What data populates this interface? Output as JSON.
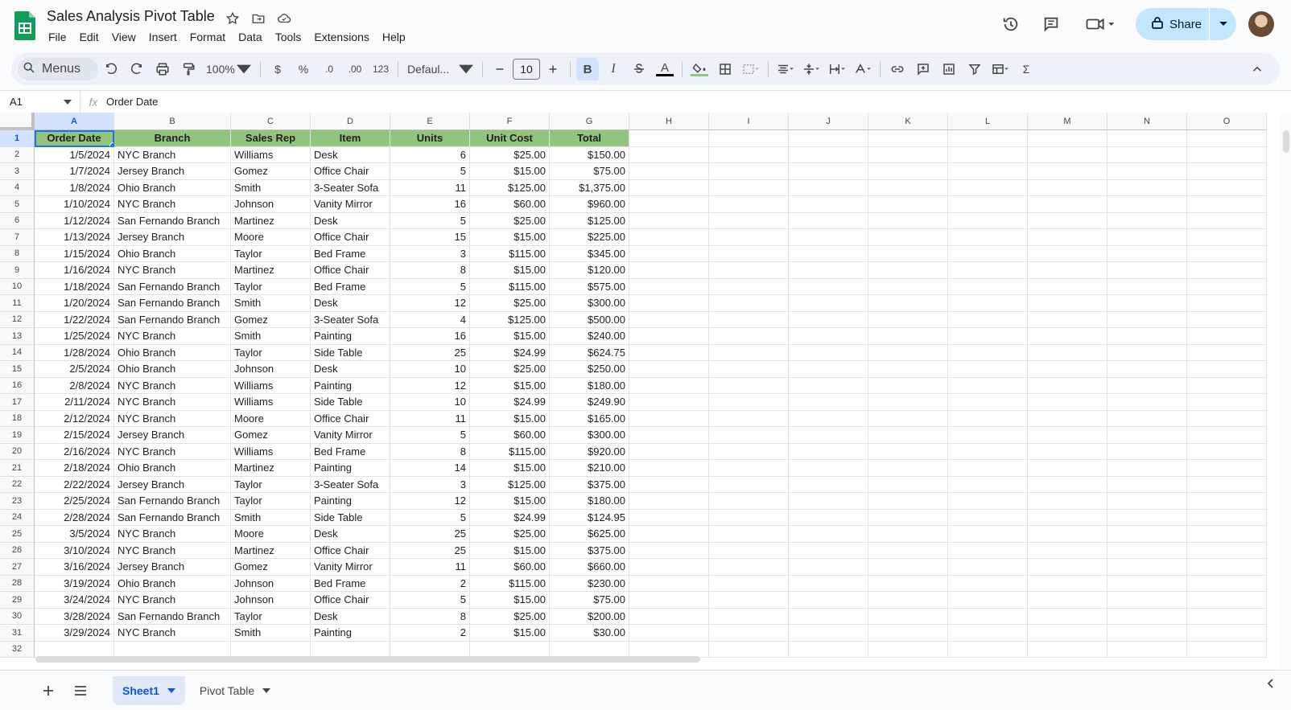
{
  "doc": {
    "title": "Sales Analysis Pivot Table"
  },
  "menu": [
    "File",
    "Edit",
    "View",
    "Insert",
    "Format",
    "Data",
    "Tools",
    "Extensions",
    "Help"
  ],
  "share": {
    "label": "Share"
  },
  "toolbar": {
    "search_label": "Menus",
    "zoom": "100%",
    "currency": "$",
    "percent": "%",
    "dec_decrease": ".0",
    "dec_increase": ".00",
    "format_123": "123",
    "font": "Defaul...",
    "font_size": "10",
    "bold": "B",
    "italic": "I",
    "text_color_glyph": "A",
    "sigma": "Σ"
  },
  "formula_bar": {
    "cell_ref": "A1",
    "fx": "fx",
    "content": "Order Date"
  },
  "columns": [
    "A",
    "B",
    "C",
    "D",
    "E",
    "F",
    "G",
    "H",
    "I",
    "J",
    "K",
    "L",
    "M",
    "N",
    "O"
  ],
  "row_numbers": [
    "1",
    "2",
    "3",
    "4",
    "5",
    "6",
    "7",
    "8",
    "9",
    "10",
    "11",
    "12",
    "13",
    "14",
    "15",
    "16",
    "17",
    "18",
    "19",
    "20",
    "21",
    "22",
    "23",
    "24",
    "25",
    "26",
    "27",
    "28",
    "29",
    "30",
    "31",
    "32"
  ],
  "headers": [
    "Order Date",
    "Branch",
    "Sales Rep",
    "Item",
    "Units",
    "Unit Cost",
    "Total"
  ],
  "rows": [
    [
      "1/5/2024",
      "NYC Branch",
      "Williams",
      "Desk",
      "6",
      "$25.00",
      "$150.00"
    ],
    [
      "1/7/2024",
      "Jersey Branch",
      "Gomez",
      "Office Chair",
      "5",
      "$15.00",
      "$75.00"
    ],
    [
      "1/8/2024",
      "Ohio Branch",
      "Smith",
      "3-Seater Sofa",
      "11",
      "$125.00",
      "$1,375.00"
    ],
    [
      "1/10/2024",
      "NYC Branch",
      "Johnson",
      "Vanity Mirror",
      "16",
      "$60.00",
      "$960.00"
    ],
    [
      "1/12/2024",
      "San Fernando Branch",
      "Martinez",
      "Desk",
      "5",
      "$25.00",
      "$125.00"
    ],
    [
      "1/13/2024",
      "Jersey Branch",
      "Moore",
      "Office Chair",
      "15",
      "$15.00",
      "$225.00"
    ],
    [
      "1/15/2024",
      "Ohio Branch",
      "Taylor",
      "Bed Frame",
      "3",
      "$115.00",
      "$345.00"
    ],
    [
      "1/16/2024",
      "NYC Branch",
      "Martinez",
      "Office Chair",
      "8",
      "$15.00",
      "$120.00"
    ],
    [
      "1/18/2024",
      "San Fernando Branch",
      "Taylor",
      "Bed Frame",
      "5",
      "$115.00",
      "$575.00"
    ],
    [
      "1/20/2024",
      "San Fernando Branch",
      "Smith",
      "Desk",
      "12",
      "$25.00",
      "$300.00"
    ],
    [
      "1/22/2024",
      "San Fernando Branch",
      "Gomez",
      "3-Seater Sofa",
      "4",
      "$125.00",
      "$500.00"
    ],
    [
      "1/25/2024",
      "NYC Branch",
      "Smith",
      "Painting",
      "16",
      "$15.00",
      "$240.00"
    ],
    [
      "1/28/2024",
      "Ohio Branch",
      "Taylor",
      "Side Table",
      "25",
      "$24.99",
      "$624.75"
    ],
    [
      "2/5/2024",
      "Ohio Branch",
      "Johnson",
      "Desk",
      "10",
      "$25.00",
      "$250.00"
    ],
    [
      "2/8/2024",
      "NYC Branch",
      "Williams",
      "Painting",
      "12",
      "$15.00",
      "$180.00"
    ],
    [
      "2/11/2024",
      "NYC Branch",
      "Williams",
      "Side Table",
      "10",
      "$24.99",
      "$249.90"
    ],
    [
      "2/12/2024",
      "NYC Branch",
      "Moore",
      "Office Chair",
      "11",
      "$15.00",
      "$165.00"
    ],
    [
      "2/15/2024",
      "Jersey Branch",
      "Gomez",
      "Vanity Mirror",
      "5",
      "$60.00",
      "$300.00"
    ],
    [
      "2/16/2024",
      "NYC Branch",
      "Williams",
      "Bed Frame",
      "8",
      "$115.00",
      "$920.00"
    ],
    [
      "2/18/2024",
      "Ohio Branch",
      "Martinez",
      "Painting",
      "14",
      "$15.00",
      "$210.00"
    ],
    [
      "2/22/2024",
      "Jersey Branch",
      "Taylor",
      "3-Seater Sofa",
      "3",
      "$125.00",
      "$375.00"
    ],
    [
      "2/25/2024",
      "San Fernando Branch",
      "Taylor",
      "Painting",
      "12",
      "$15.00",
      "$180.00"
    ],
    [
      "2/28/2024",
      "San Fernando Branch",
      "Smith",
      "Side Table",
      "5",
      "$24.99",
      "$124.95"
    ],
    [
      "3/5/2024",
      "NYC Branch",
      "Moore",
      "Desk",
      "25",
      "$25.00",
      "$625.00"
    ],
    [
      "3/10/2024",
      "NYC Branch",
      "Martinez",
      "Office Chair",
      "25",
      "$15.00",
      "$375.00"
    ],
    [
      "3/16/2024",
      "Jersey Branch",
      "Gomez",
      "Vanity Mirror",
      "11",
      "$60.00",
      "$660.00"
    ],
    [
      "3/19/2024",
      "Ohio Branch",
      "Johnson",
      "Bed Frame",
      "2",
      "$115.00",
      "$230.00"
    ],
    [
      "3/24/2024",
      "NYC Branch",
      "Johnson",
      "Office Chair",
      "5",
      "$15.00",
      "$75.00"
    ],
    [
      "3/28/2024",
      "San Fernando Branch",
      "Taylor",
      "Desk",
      "8",
      "$25.00",
      "$200.00"
    ],
    [
      "3/29/2024",
      "NYC Branch",
      "Smith",
      "Painting",
      "2",
      "$15.00",
      "$30.00"
    ]
  ],
  "sheets": [
    {
      "label": "Sheet1",
      "active": true
    },
    {
      "label": "Pivot Table",
      "active": false
    }
  ],
  "colors": {
    "header_fill": "#93c47d",
    "selection": "#1a73e8",
    "share_bg": "#c2e7ff",
    "logo_green": "#0f9d58"
  }
}
